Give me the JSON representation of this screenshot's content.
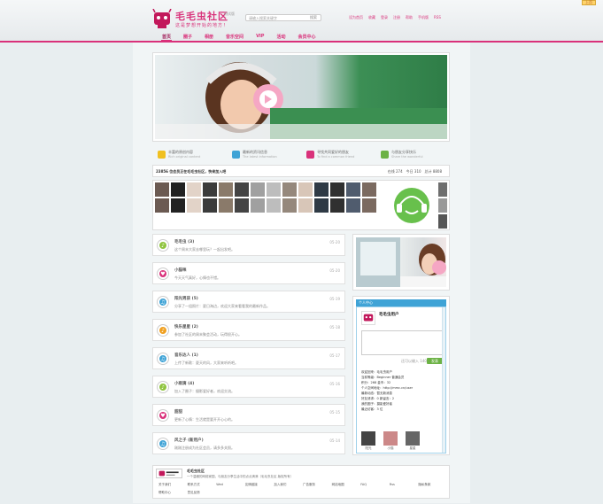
{
  "toplink": {
    "label": "上页"
  },
  "header": {
    "title": "毛毛虫社区",
    "badge": "测试版",
    "slogan": "这是梦想开始的地方！",
    "search_placeholder": "请输入搜索关键字",
    "search_button": "搜索",
    "toplinks": [
      "设为首页",
      "收藏",
      "登录",
      "注册",
      "帮助",
      "手机版",
      "RSS"
    ]
  },
  "nav": {
    "items": [
      "首页",
      "圈子",
      "相册",
      "音乐空间",
      "VIP",
      "活动",
      "会员中心"
    ]
  },
  "features": [
    {
      "title": "丰富的原创内容",
      "sub": "Rich original content",
      "color": "#f0c020"
    },
    {
      "title": "最新的资讯信息",
      "sub": "The latest information",
      "color": "#3fa3d6"
    },
    {
      "title": "寻找共同爱好的朋友",
      "sub": "To find a common friend",
      "color": "#d9317a"
    },
    {
      "title": "与朋友分享快乐",
      "sub": "Share the wonderful",
      "color": "#6cb245"
    }
  ],
  "stats": {
    "left": "23856 位会员正在毛毛虫社区，快来加入吧",
    "right": [
      "在线 274",
      "今日 310",
      "总计 8808"
    ]
  },
  "feed": [
    {
      "title": "毛毛虫 (3)",
      "desc": "这个周末大家去哪里玩？一起出发吧。",
      "time": "05-20",
      "color": "#8fc43f",
      "glyph": "♪"
    },
    {
      "title": "小猫咪",
      "desc": "今天天气真好，心情也不错。",
      "time": "05-20",
      "color": "#d9317a",
      "glyph": "♥"
    },
    {
      "title": "阳光男孩 (5)",
      "desc": "分享了一组照片：夏日海边，欢迎大家来看看我的最新作品。",
      "time": "05-19",
      "color": "#3fa3d6",
      "glyph": "♫"
    },
    {
      "title": "快乐星星 (2)",
      "desc": "参加了社区的周末聚会活动，玩得很开心。",
      "time": "05-18",
      "color": "#f0a020",
      "glyph": "♪"
    },
    {
      "title": "音乐达人 (1)",
      "desc": "上传了新歌：夏天的风，大家来听听吧。",
      "time": "05-17",
      "color": "#3fa3d6",
      "glyph": "♫"
    },
    {
      "title": "小雨滴 (4)",
      "desc": "加入了圈子：摄影爱好者，欢迎交流。",
      "time": "05-16",
      "color": "#8fc43f",
      "glyph": "♪"
    },
    {
      "title": "甜甜",
      "desc": "更新了心情：生活就是要开开心心的。",
      "time": "05-15",
      "color": "#d9317a",
      "glyph": "♥"
    },
    {
      "title": "风之子 (新用户)",
      "desc": "刚刚注册成为社区会员，请多多关照。",
      "time": "05-14",
      "color": "#3fa3d6",
      "glyph": "♫"
    }
  ],
  "user_panel": {
    "head": "个人中心",
    "name": "毛毛虫用户",
    "counter": "还可以输入 140 字",
    "post_button": "发表",
    "lines": [
      "欢迎回来：毛毛虫用户",
      "当前等级：Beginner 普通会员",
      "积分：268    金币：32",
      "个人空间地址：http://mmc.cn/user",
      "最新动态：暂无新消息",
      "好友请求：0    新留言：2",
      "我的圈子：摄影爱好者",
      "最近访客：3 位"
    ],
    "friends": [
      "阳光",
      "小猫",
      "星星"
    ]
  },
  "footer": {
    "title": "毛毛虫社区",
    "desc": "一个温暖的网络家园，与朋友分享生活中的点点滴滴（毛毛虫社区 版权所有）",
    "links": [
      "关于我们",
      "联系方式",
      "Wed",
      "友情链接",
      "加入我们",
      "广告服务",
      "网站地图",
      "FAQ",
      "Rss",
      "隐私条款",
      "帮助中心",
      "意见反馈"
    ]
  }
}
